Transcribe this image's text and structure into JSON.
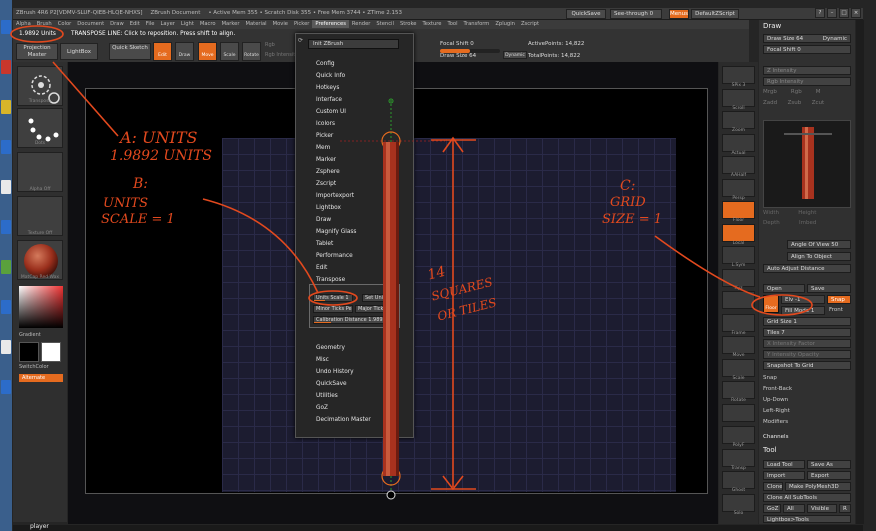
{
  "titlebar": {
    "app": "ZBrush 4R6 P2[VDMV-SLUF-QIEB-HLQE-NHXS]",
    "doc": "ZBrush Document",
    "stats": "• Active Mem 355 • Scratch Disk 355 • Free Mem 3744 • ZTime 2.153",
    "menus": [
      "Alpha",
      "Brush",
      "Color",
      "Document",
      "Draw",
      "Edit",
      "File",
      "Layer",
      "Light",
      "Macro",
      "Marker",
      "Material",
      "Movie",
      "Picker",
      "Preferences",
      "Render",
      "Stencil",
      "Stroke",
      "Texture",
      "Tool",
      "Transform",
      "Zplugin",
      "Zscript"
    ],
    "quicksave": "QuickSave",
    "seethrough": "See-through",
    "seethrough_value": "0",
    "menus_btn": "Menus",
    "defaultscript": "DefaultZScript"
  },
  "toolbar": {
    "units_value": "1.9892 Units",
    "hint": "TRANSPOSE LINE: Click to reposition. Press shift to align.",
    "projection_master": "Projection Master",
    "lightbox": "LightBox",
    "quick_sketch": "Quick Sketch",
    "edit": "Edit",
    "draw": "Draw",
    "move": "Move",
    "scale": "Scale",
    "rotate": "Rotate",
    "rgb": "Rgb",
    "rgb_intensity": "Rgb Intensity",
    "focal_shift_label": "Focal Shift 0",
    "draw_size_label": "Draw Size 64",
    "dynamic": "Dynamic",
    "active_points": "ActivePoints: 14,822",
    "total_points": "TotalPoints: 14,822"
  },
  "leftpanel": {
    "thumbs": [
      "Transpose",
      "Dots",
      "Alpha Off",
      "Texture Off",
      "MatCap Red Wax"
    ],
    "gradient": "Gradient",
    "switchcolor": "SwitchColor",
    "alternate": "Alternate"
  },
  "preferences_menu": {
    "search": "Init ZBrush",
    "items": [
      "Config",
      "Quick Info",
      "Hotkeys",
      "Interface",
      "Custom UI",
      "Icolors",
      "Picker",
      "Mem",
      "Marker",
      "Zsphere",
      "Zscript",
      "Importexport",
      "Lightbox",
      "Draw",
      "Magnify Glass",
      "Tablet",
      "Performance",
      "Edit",
      "Transpose",
      "Transpose Units",
      "Geometry",
      "Misc",
      "Undo History",
      "QuickSave",
      "Utilities",
      "GoZ",
      "Decimation Master"
    ]
  },
  "transpose_units": {
    "units_scale": "Units Scale 1",
    "set_units": "Set Units",
    "minor_ticks": "Minor Ticks Pe",
    "major_ticks": "Major Ticks Pe",
    "calibration": "Calibration Distance 1.9892"
  },
  "righticons": [
    "SPix 3",
    "Scroll",
    "Zoom",
    "Actual",
    "AAHalf",
    "Persp",
    "Floor",
    "Local",
    "L.Sym",
    "Xyz",
    "",
    "Frame",
    "Move",
    "Scale",
    "Rotate",
    "",
    "PolyF",
    "Transp",
    "Ghost",
    "Solo"
  ],
  "rightpanel": {
    "title": "Draw",
    "draw_size": "Draw Size 64",
    "dynamic": "Dynamic",
    "focal_shift": "Focal Shift 0",
    "z_intensity": "Z Intensity",
    "rgb_intensity": "Rgb Intensity",
    "weight": "Weight",
    "mrgb": "Mrgb",
    "rgb": "Rgb",
    "m": "M",
    "zadd": "Zadd",
    "zsub": "Zsub",
    "zcut": "Zcut",
    "width": "Width",
    "height": "Height",
    "depth": "Depth",
    "imbed": "Imbed",
    "angle_of_view": "Angle Of View 50",
    "align_to_object": "Align To Object",
    "auto_adjust": "Auto Adjust Distance",
    "open": "Open",
    "save": "Save",
    "elv": "Elv -1",
    "snap": "Snap",
    "floor": "Floor",
    "fill_mode": "Fill Mode 1",
    "front": "Front",
    "grid_size": "Grid Size 1",
    "tiles": "Tiles 7",
    "x_intensity": "X Intensity Factor",
    "y_intensity": "Y Intensity Opacity",
    "snapshot": "Snapshot To Grid",
    "snap2": "Snap",
    "frontback": "Front-Back",
    "updown": "Up-Down",
    "leftright": "Left-Right",
    "modifiers": "Modifiers",
    "channels": "Channels",
    "tool": "Tool",
    "load_tool": "Load Tool",
    "save_as": "Save As",
    "import": "Import",
    "export": "Export",
    "clone": "Clone",
    "make_polymesh": "Make PolyMesh3D",
    "clone_all": "Clone All SubTools",
    "goz": "GoZ",
    "all": "All",
    "visible": "Visible",
    "r": "R",
    "lightbox_tools": "Lightbox>Tools"
  },
  "bottom": {
    "player": "player"
  },
  "annotations": {
    "a_line1": "A: UNITS",
    "a_line2": "1.9892 UNITS",
    "b_line1": "B:",
    "b_line2": "UNITS",
    "b_line3": "SCALE = 1",
    "c_line1": "C:",
    "c_line2": "GRID",
    "c_line3": "SIZE = 1",
    "d_line1": "14",
    "d_line2": "SQUARES",
    "d_line3": "OR TILES"
  },
  "colors": {
    "accent": "#e56b1f",
    "ink": "#e2491e",
    "cylinder": "#a8321e"
  }
}
